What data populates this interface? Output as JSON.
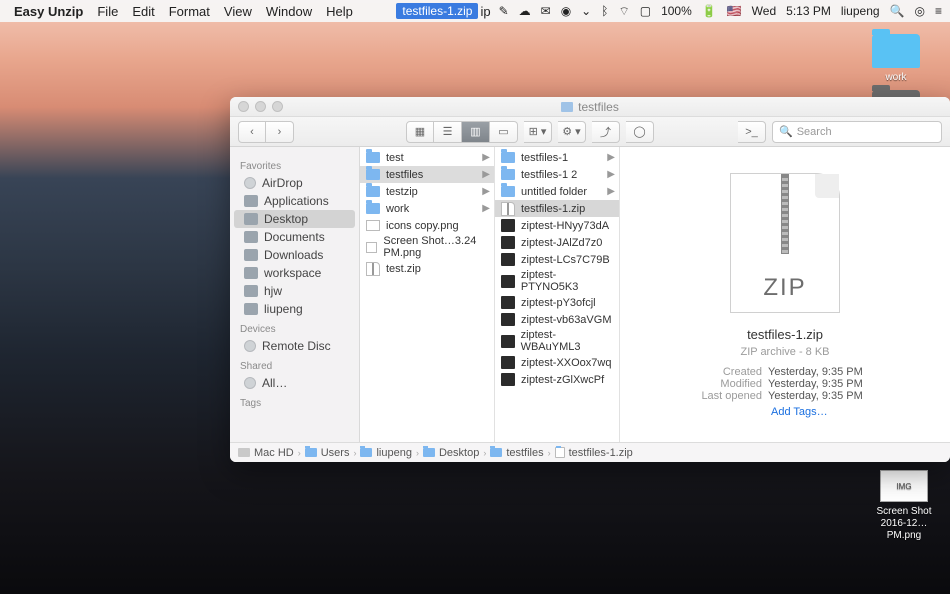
{
  "menubar": {
    "app": "Easy Unzip",
    "menus": [
      "File",
      "Edit",
      "Format",
      "View",
      "Window",
      "Help"
    ],
    "active_file": "testfiles-1.zip",
    "right": {
      "day": "Wed",
      "time": "5:13 PM",
      "user": "liupeng",
      "battery": "100%"
    }
  },
  "desktop": {
    "icons": [
      {
        "name": "work",
        "kind": "folder"
      },
      {
        "name": "",
        "kind": "folder-dim"
      },
      {
        "name": "Screen Shot 2016-12…PM.png",
        "kind": "screenshot"
      }
    ]
  },
  "finder": {
    "title": "testfiles",
    "search_placeholder": "Search",
    "sidebar": {
      "sections": [
        {
          "label": "Favorites",
          "items": [
            {
              "label": "AirDrop",
              "sel": false
            },
            {
              "label": "Applications",
              "sel": false
            },
            {
              "label": "Desktop",
              "sel": true
            },
            {
              "label": "Documents",
              "sel": false
            },
            {
              "label": "Downloads",
              "sel": false
            },
            {
              "label": "workspace",
              "sel": false
            },
            {
              "label": "hjw",
              "sel": false
            },
            {
              "label": "liupeng",
              "sel": false
            }
          ]
        },
        {
          "label": "Devices",
          "items": [
            {
              "label": "Remote Disc",
              "sel": false
            }
          ]
        },
        {
          "label": "Shared",
          "items": [
            {
              "label": "All…",
              "sel": false
            }
          ]
        },
        {
          "label": "Tags",
          "items": []
        }
      ]
    },
    "columns": [
      [
        {
          "label": "test",
          "kind": "folder",
          "chev": true
        },
        {
          "label": "testfiles",
          "kind": "folder",
          "chev": true,
          "sel": true
        },
        {
          "label": "testzip",
          "kind": "folder",
          "chev": true
        },
        {
          "label": "work",
          "kind": "folder",
          "chev": true
        },
        {
          "label": "icons copy.png",
          "kind": "image"
        },
        {
          "label": "Screen Shot…3.24 PM.png",
          "kind": "image"
        },
        {
          "label": "test.zip",
          "kind": "zip"
        }
      ],
      [
        {
          "label": "testfiles-1",
          "kind": "folder",
          "chev": true
        },
        {
          "label": "testfiles-1 2",
          "kind": "folder",
          "chev": true
        },
        {
          "label": "untitled folder",
          "kind": "folder",
          "chev": true
        },
        {
          "label": "testfiles-1.zip",
          "kind": "zip",
          "sel": true
        },
        {
          "label": "ziptest-HNyy73dA",
          "kind": "black"
        },
        {
          "label": "ziptest-JAlZd7z0",
          "kind": "black"
        },
        {
          "label": "ziptest-LCs7C79B",
          "kind": "black"
        },
        {
          "label": "ziptest-PTYNO5K3",
          "kind": "black"
        },
        {
          "label": "ziptest-pY3ofcjl",
          "kind": "black"
        },
        {
          "label": "ziptest-vb63aVGM",
          "kind": "black"
        },
        {
          "label": "ziptest-WBAuYML3",
          "kind": "black"
        },
        {
          "label": "ziptest-XXOox7wq",
          "kind": "black"
        },
        {
          "label": "ziptest-zGlXwcPf",
          "kind": "black"
        }
      ]
    ],
    "preview": {
      "name": "testfiles-1.zip",
      "type": "ZIP archive - 8 KB",
      "big_label": "ZIP",
      "meta": [
        {
          "k": "Created",
          "v": "Yesterday, 9:35 PM"
        },
        {
          "k": "Modified",
          "v": "Yesterday, 9:35 PM"
        },
        {
          "k": "Last opened",
          "v": "Yesterday, 9:35 PM"
        }
      ],
      "addtags": "Add Tags…"
    },
    "pathbar": [
      "Mac HD",
      "Users",
      "liupeng",
      "Desktop",
      "testfiles",
      "testfiles-1.zip"
    ]
  }
}
